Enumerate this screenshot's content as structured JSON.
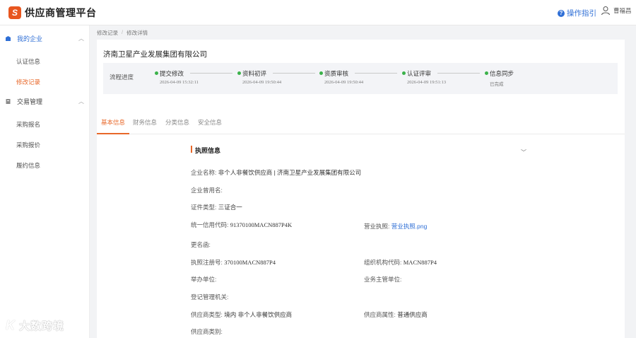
{
  "app": {
    "title": "供应商管理平台",
    "logo_letter": "S",
    "accent": "#e8682a",
    "brand": "#e8561f",
    "link": "#2f6fd6"
  },
  "header": {
    "help_label": "操作指引",
    "user_name": "曹福昌"
  },
  "sidebar": {
    "groups": [
      {
        "label": "我的企业",
        "icon": "building-icon",
        "items": [
          {
            "label": "认证信息"
          },
          {
            "label": "修改记录",
            "active": true
          }
        ]
      },
      {
        "label": "交易管理",
        "icon": "document-icon",
        "items": [
          {
            "label": "采购报名"
          },
          {
            "label": "采购报价"
          },
          {
            "label": "履约信息"
          }
        ]
      }
    ]
  },
  "breadcrumb": {
    "items": [
      "修改记录",
      "修改详情"
    ]
  },
  "company_name": "济南卫星产业发展集团有限公司",
  "process": {
    "label": "流程进度",
    "steps": [
      {
        "title": "提交修改",
        "time": "2026-04-09 15:32:11",
        "status_color": "#3bb24a"
      },
      {
        "title": "资料初评",
        "time": "2026-04-09 19:50:44",
        "status_color": "#3bb24a"
      },
      {
        "title": "资质审核",
        "time": "2026-04-09 19:50:44",
        "status_color": "#3bb24a"
      },
      {
        "title": "认证评审",
        "time": "2026-04-09 19:51:13",
        "status_color": "#3bb24a"
      },
      {
        "title": "信息同步",
        "time": "已完成",
        "status_color": "#3bb24a"
      }
    ]
  },
  "tabs": [
    {
      "label": "基本信息",
      "active": true
    },
    {
      "label": "财务信息"
    },
    {
      "label": "分类信息"
    },
    {
      "label": "安全信息"
    }
  ],
  "license_section": {
    "title": "执照信息",
    "fields": {
      "enterprise_name": {
        "label": "企业名称:",
        "value": "非个人非餐饮供应商 | 济南卫星产业发展集团有限公司"
      },
      "former_name": {
        "label": "企业曾用名:",
        "value": ""
      },
      "cert_type": {
        "label": "证件类型:",
        "value": "三证合一"
      },
      "credit_code": {
        "label": "统一信用代码:",
        "value": "91370100MACN887P4K"
      },
      "business_license": {
        "label": "营业执照:",
        "value": "营业执照.png"
      },
      "rename_letter": {
        "label": "更名函:",
        "value": ""
      },
      "license_reg_no": {
        "label": "执照注册号:",
        "value": "370100MACN887P4"
      },
      "org_code": {
        "label": "组织机构代码:",
        "value": "MACN887P4"
      },
      "sponsor": {
        "label": "举办单位:",
        "value": ""
      },
      "supervisor": {
        "label": "业务主管单位:",
        "value": ""
      },
      "registration_authority": {
        "label": "登记管理机关:",
        "value": ""
      },
      "supplier_type": {
        "label": "供应商类型:",
        "value": "境内 非个人非餐饮供应商"
      },
      "supplier_attribute": {
        "label": "供应商属性:",
        "value": "普通供应商"
      },
      "supplier_category": {
        "label": "供应商类别:",
        "value": ""
      }
    }
  },
  "watermark": {
    "text": "大数跨境",
    "mark": "K"
  }
}
